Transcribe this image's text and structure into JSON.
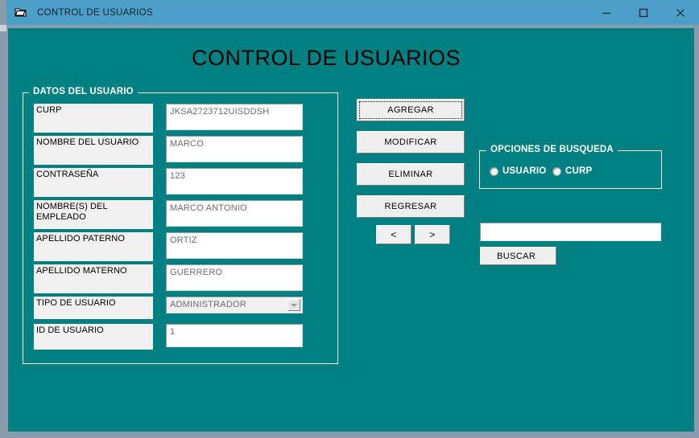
{
  "window": {
    "title": "CONTROL DE USUARIOS",
    "icon": "window-folder-icon",
    "controls": {
      "minimize": "minimize-icon",
      "maximize": "maximize-icon",
      "close": "close-icon"
    },
    "colors": {
      "titlebar": "#4d9fc9",
      "client_background": "#008080",
      "frame": "#8a9bab",
      "control_face": "#efefef",
      "input_text": "#6e6e6e"
    }
  },
  "main": {
    "heading": "CONTROL DE USUARIOS",
    "datos_group": {
      "legend": "DATOS DEL USUARIO",
      "fields": [
        {
          "label": "CURP",
          "value": "JKSA2723712UISDDSH",
          "type": "text"
        },
        {
          "label": "NOMBRE DEL USUARIO",
          "value": "MARCO",
          "type": "text"
        },
        {
          "label": "CONTRASEÑA",
          "value": "123",
          "type": "text"
        },
        {
          "label": "NOMBRE(S) DEL EMPLEADO",
          "value": "MARCO ANTONIO",
          "type": "text"
        },
        {
          "label": "APELLIDO PATERNO",
          "value": "ORTIZ",
          "type": "text"
        },
        {
          "label": "APELLIDO MATERNO",
          "value": "GUERRERO",
          "type": "text"
        },
        {
          "label": "TIPO DE USUARIO",
          "value": "ADMINISTRADOR",
          "type": "combo"
        },
        {
          "label": "ID DE USUARIO",
          "value": "1",
          "type": "text"
        }
      ]
    },
    "actions": {
      "agregar": "AGREGAR",
      "modificar": "MODIFICAR",
      "eliminar": "ELIMINAR",
      "regresar": "REGRESAR",
      "prev": "<",
      "next": ">"
    },
    "busqueda_group": {
      "legend": "OPCIONES DE BUSQUEDA",
      "options": [
        {
          "label": "USUARIO",
          "selected": false
        },
        {
          "label": "CURP",
          "selected": false
        }
      ],
      "search_value": "",
      "search_placeholder": "",
      "buscar_label": "BUSCAR"
    }
  }
}
